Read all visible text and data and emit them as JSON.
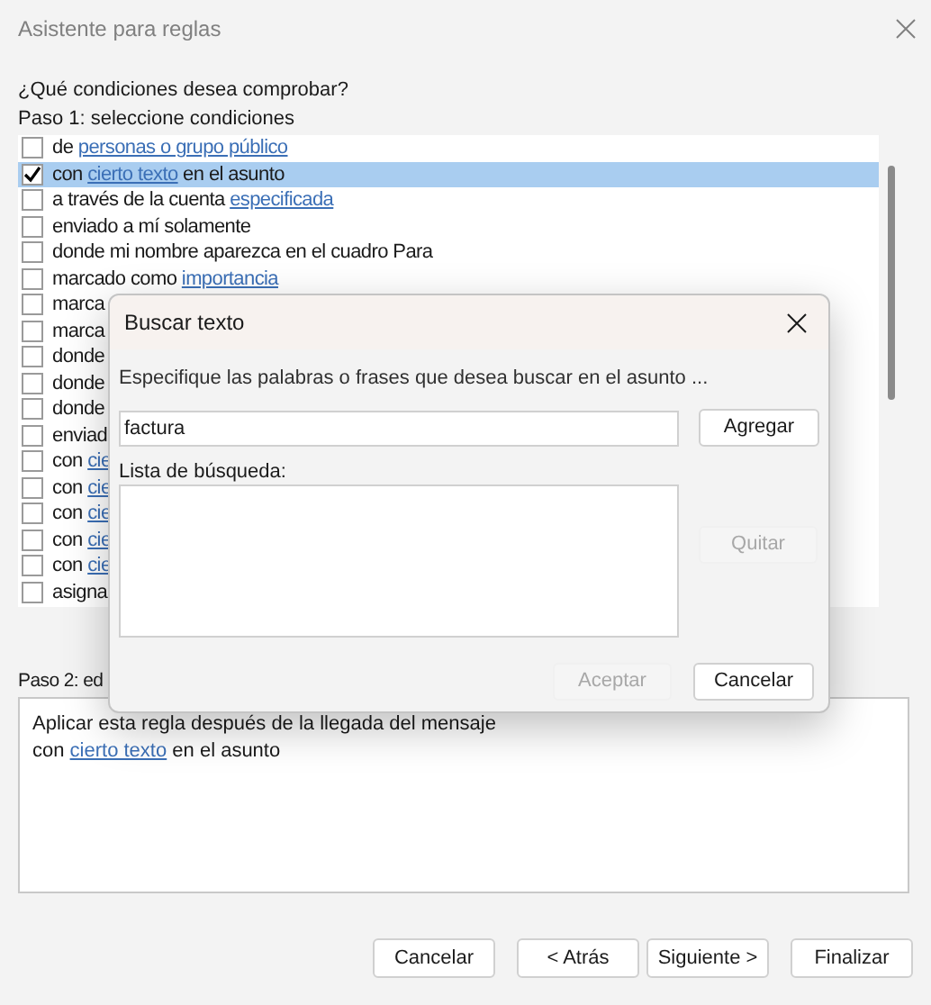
{
  "window": {
    "title": "Asistente para reglas"
  },
  "question": "¿Qué condiciones desea comprobar?",
  "step1_label": "Paso 1: seleccione condiciones",
  "conditions": [
    {
      "checked": false,
      "selected": false,
      "segments": [
        {
          "text": "de ",
          "link": false
        },
        {
          "text": "personas o grupo público",
          "link": true
        }
      ]
    },
    {
      "checked": true,
      "selected": true,
      "segments": [
        {
          "text": "con ",
          "link": false
        },
        {
          "text": "cierto texto",
          "link": true
        },
        {
          "text": " en el asunto",
          "link": false
        }
      ]
    },
    {
      "checked": false,
      "selected": false,
      "segments": [
        {
          "text": "a través de la cuenta ",
          "link": false
        },
        {
          "text": "especificada",
          "link": true
        }
      ]
    },
    {
      "checked": false,
      "selected": false,
      "segments": [
        {
          "text": "enviado a mí solamente",
          "link": false
        }
      ]
    },
    {
      "checked": false,
      "selected": false,
      "segments": [
        {
          "text": "donde mi nombre aparezca en el cuadro Para",
          "link": false
        }
      ]
    },
    {
      "checked": false,
      "selected": false,
      "segments": [
        {
          "text": "marcado como ",
          "link": false
        },
        {
          "text": "importancia",
          "link": true
        }
      ]
    },
    {
      "checked": false,
      "selected": false,
      "segments": [
        {
          "text": "marca",
          "link": false
        }
      ]
    },
    {
      "checked": false,
      "selected": false,
      "segments": [
        {
          "text": "marca",
          "link": false
        }
      ]
    },
    {
      "checked": false,
      "selected": false,
      "segments": [
        {
          "text": "donde",
          "link": false
        }
      ]
    },
    {
      "checked": false,
      "selected": false,
      "segments": [
        {
          "text": "donde",
          "link": false
        }
      ]
    },
    {
      "checked": false,
      "selected": false,
      "segments": [
        {
          "text": "donde",
          "link": false
        }
      ]
    },
    {
      "checked": false,
      "selected": false,
      "segments": [
        {
          "text": "enviad",
          "link": false
        }
      ]
    },
    {
      "checked": false,
      "selected": false,
      "segments": [
        {
          "text": "con ",
          "link": false
        },
        {
          "text": "cie",
          "link": true
        }
      ]
    },
    {
      "checked": false,
      "selected": false,
      "segments": [
        {
          "text": "con ",
          "link": false
        },
        {
          "text": "cie",
          "link": true
        }
      ]
    },
    {
      "checked": false,
      "selected": false,
      "segments": [
        {
          "text": "con ",
          "link": false
        },
        {
          "text": "cie",
          "link": true
        }
      ]
    },
    {
      "checked": false,
      "selected": false,
      "segments": [
        {
          "text": "con ",
          "link": false
        },
        {
          "text": "cie",
          "link": true
        }
      ]
    },
    {
      "checked": false,
      "selected": false,
      "segments": [
        {
          "text": "con ",
          "link": false
        },
        {
          "text": "cie",
          "link": true
        }
      ]
    },
    {
      "checked": false,
      "selected": false,
      "segments": [
        {
          "text": "asigna",
          "link": false
        }
      ]
    }
  ],
  "step2_label": "Paso 2: ed",
  "rule_description": [
    [
      {
        "text": "Aplicar esta regla después de la llegada del mensaje",
        "link": false
      }
    ],
    [
      {
        "text": "con ",
        "link": false
      },
      {
        "text": "cierto texto",
        "link": true
      },
      {
        "text": " en el asunto",
        "link": false
      }
    ]
  ],
  "buttons": [
    {
      "label": "Cancelar",
      "disabled": false
    },
    {
      "label": "< Atrás",
      "disabled": false
    },
    {
      "label": "Siguiente >",
      "disabled": false
    },
    {
      "label": "Finalizar",
      "disabled": false
    }
  ],
  "dialog": {
    "title": "Buscar texto",
    "instructions": "Especifique las palabras o frases que desea buscar en el asunto ...",
    "input_value": "factura",
    "add_button": {
      "label": "Agregar",
      "disabled": false
    },
    "list_label": "Lista de búsqueda:",
    "remove_button": {
      "label": "Quitar",
      "disabled": true
    },
    "ok_button": {
      "label": "Aceptar",
      "disabled": true
    },
    "cancel_button": {
      "label": "Cancelar",
      "disabled": false
    }
  }
}
